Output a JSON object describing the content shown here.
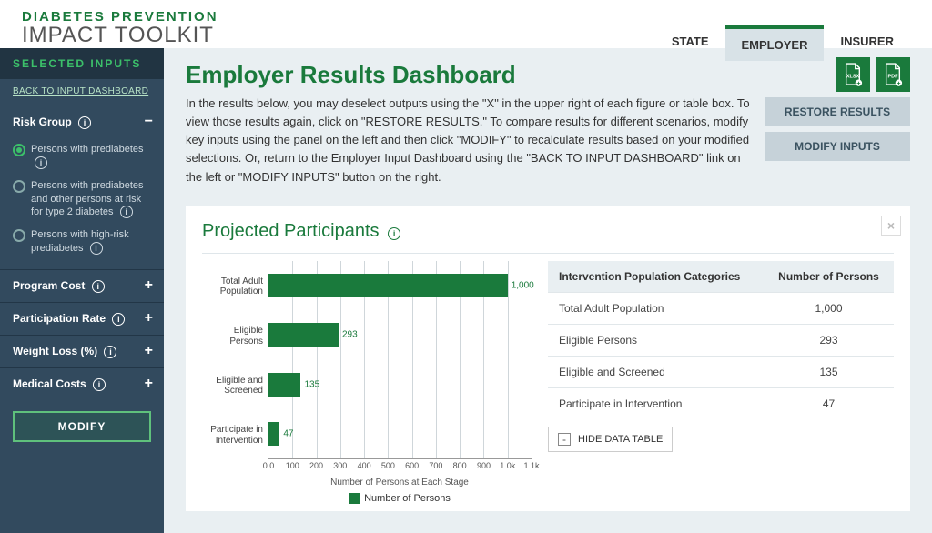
{
  "brand": {
    "line1": "DIABETES PREVENTION",
    "line2": "IMPACT TOOLKIT"
  },
  "tabs": [
    {
      "label": "STATE"
    },
    {
      "label": "EMPLOYER",
      "active": true
    },
    {
      "label": "INSURER"
    }
  ],
  "sidebar": {
    "title": "SELECTED INPUTS",
    "back": "BACK TO INPUT DASHBOARD",
    "sections": [
      {
        "label": "Risk Group",
        "expanded": true,
        "options": [
          {
            "label": "Persons with prediabetes",
            "checked": true
          },
          {
            "label": "Persons with prediabetes and other persons at risk for type 2 diabetes",
            "checked": false
          },
          {
            "label": "Persons with high-risk prediabetes",
            "checked": false
          }
        ]
      },
      {
        "label": "Program Cost",
        "expanded": false
      },
      {
        "label": "Participation Rate",
        "expanded": false
      },
      {
        "label": "Weight Loss (%)",
        "expanded": false
      },
      {
        "label": "Medical Costs",
        "expanded": false
      }
    ],
    "modify": "MODIFY"
  },
  "downloads": {
    "xlsx": "XLSX",
    "pdf": "PDF"
  },
  "actions": {
    "restore": "RESTORE RESULTS",
    "modify": "MODIFY INPUTS"
  },
  "page": {
    "title": "Employer Results Dashboard",
    "intro": "In the results below, you may deselect outputs using the \"X\" in the upper right of each figure or table box. To view those results again, click on \"RESTORE RESULTS.\" To compare results for different scenarios, modify key inputs using the panel on the left and then click \"MODIFY\" to recalculate results based on your modified selections. Or, return to the Employer Input Dashboard using the \"BACK TO INPUT DASHBOARD\" link on the left or \"MODIFY INPUTS\" button on the right."
  },
  "panel": {
    "title": "Projected Participants",
    "table": {
      "headers": [
        "Intervention Population Categories",
        "Number of Persons"
      ],
      "rows": [
        [
          "Total Adult Population",
          "1,000"
        ],
        [
          "Eligible Persons",
          "293"
        ],
        [
          "Eligible and Screened",
          "135"
        ],
        [
          "Participate in Intervention",
          "47"
        ]
      ]
    },
    "hide": "HIDE DATA TABLE"
  },
  "chart_data": {
    "type": "bar",
    "orientation": "horizontal",
    "categories": [
      "Total Adult Population",
      "Eligible Persons",
      "Eligible and Screened",
      "Participate in Intervention"
    ],
    "values": [
      1000,
      293,
      135,
      47
    ],
    "value_labels": [
      "1,000",
      "293",
      "135",
      "47"
    ],
    "xlabel": "Number of Persons at Each Stage",
    "xlim": [
      0,
      1100
    ],
    "xticks": [
      0,
      100,
      200,
      300,
      400,
      500,
      600,
      700,
      800,
      900,
      1000,
      1100
    ],
    "xtick_labels": [
      "0.0",
      "100",
      "200",
      "300",
      "400",
      "500",
      "600",
      "700",
      "800",
      "900",
      "1.0k",
      "1.1k"
    ],
    "legend": "Number of Persons",
    "color": "#1a7a3c"
  }
}
